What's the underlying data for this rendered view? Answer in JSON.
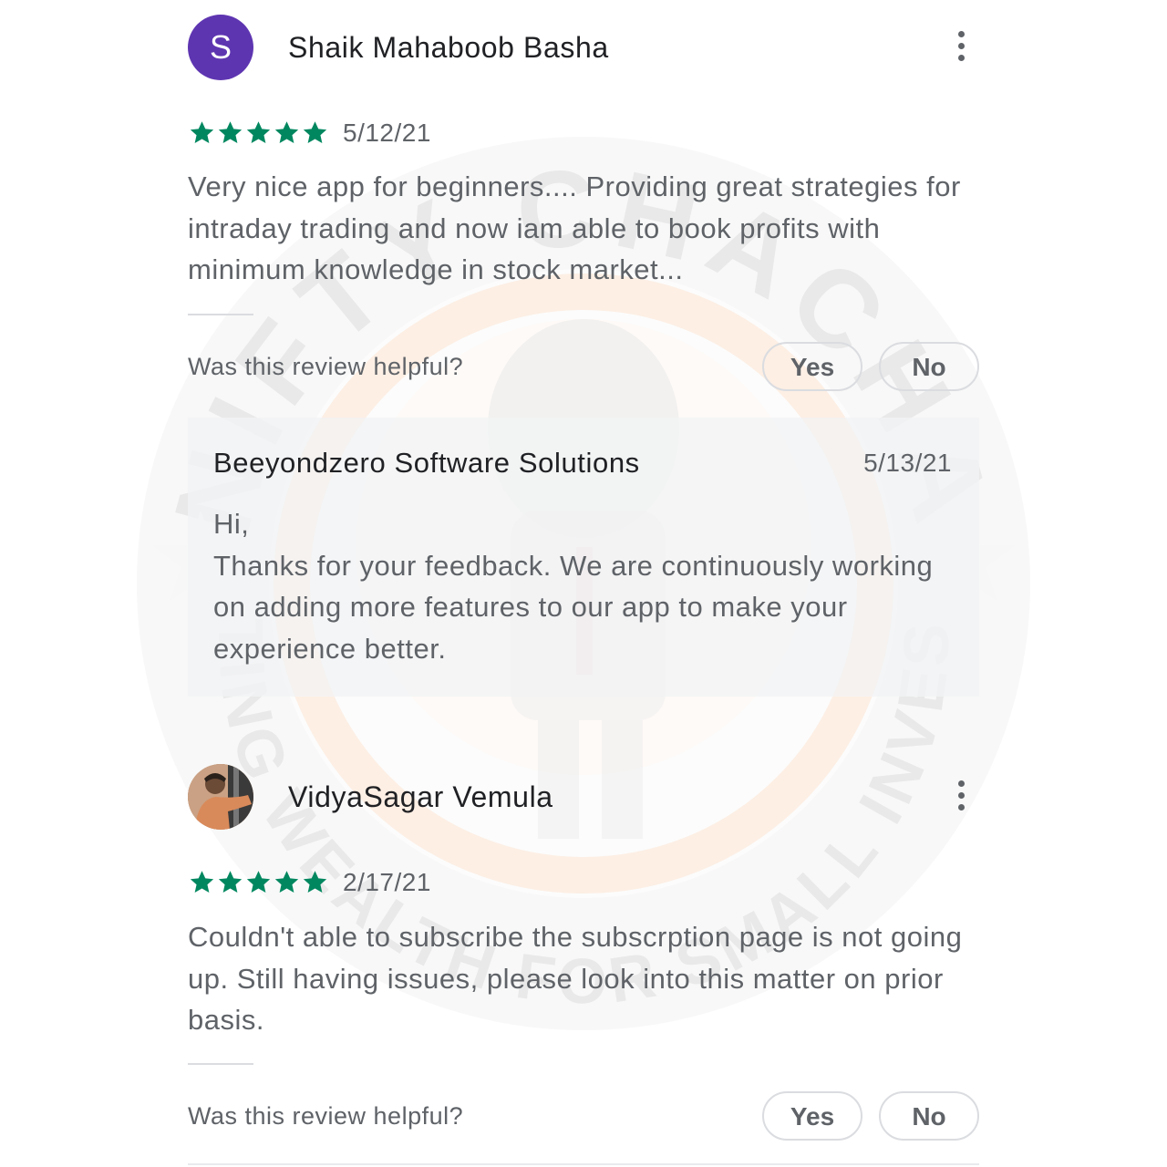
{
  "colors": {
    "star": "#01875f",
    "avatar_bg": "#5e35b1",
    "text_secondary": "#5f6368",
    "text_primary": "#202124"
  },
  "reviews": [
    {
      "avatar_letter": "S",
      "name": "Shaik Mahaboob Basha",
      "rating": 5,
      "rating_max": 5,
      "date": "5/12/21",
      "text": "Very nice app for beginners.... Providing great strategies for intraday trading and now iam able to book profits with minimum knowledge in stock market...",
      "helpful_prompt": "Was this review helpful?",
      "yes_label": "Yes",
      "no_label": "No",
      "developer_reply": {
        "name": "Beeyondzero Software Solutions",
        "date": "5/13/21",
        "text": "Hi,\nThanks for your feedback. We are continuously working on adding more features to our app to make your experience better."
      }
    },
    {
      "name": "VidyaSagar Vemula",
      "rating": 5,
      "rating_max": 5,
      "date": "2/17/21",
      "text": "Couldn't able to subscribe the subscrption page is not going up. Still having issues, please look into this matter on prior basis.",
      "helpful_prompt": "Was this review helpful?",
      "yes_label": "Yes",
      "no_label": "No"
    }
  ],
  "watermark": {
    "top_text": "NIFTY CHACHA",
    "bottom_text": "CREATING WEALTH FOR SMALL INVESTORS"
  }
}
